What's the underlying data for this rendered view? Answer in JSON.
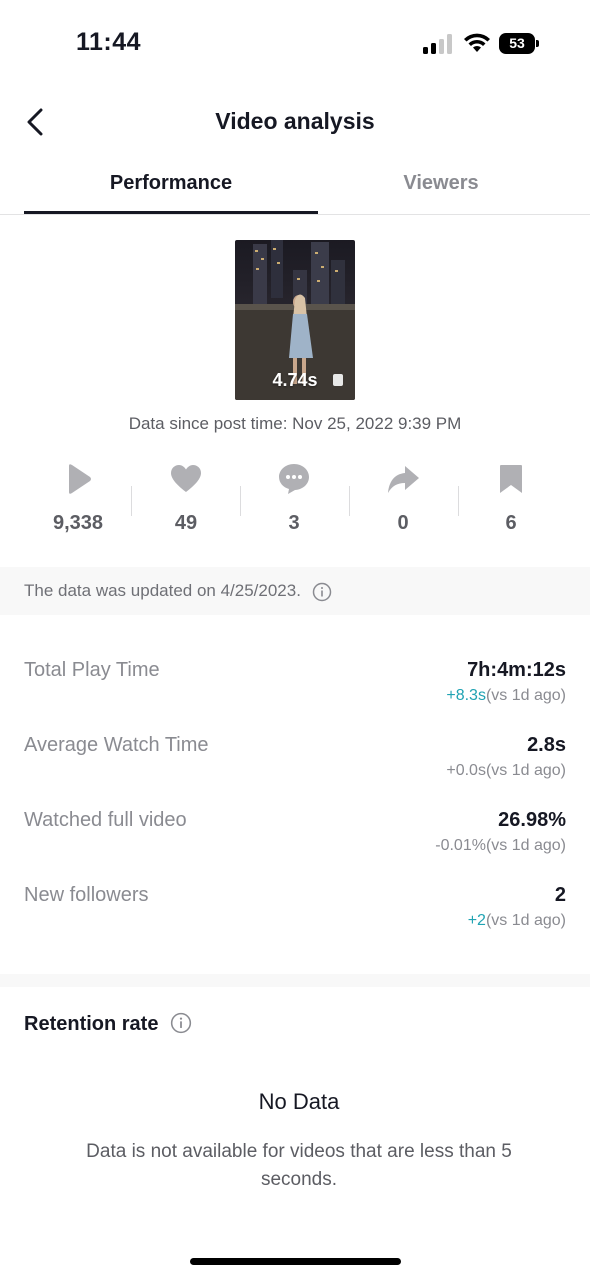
{
  "status_bar": {
    "time": "11:44",
    "battery": "53"
  },
  "header": {
    "title": "Video analysis"
  },
  "tabs": [
    {
      "label": "Performance",
      "active": true
    },
    {
      "label": "Viewers",
      "active": false
    }
  ],
  "video": {
    "duration": "4.74s",
    "post_time": "Data since post time: Nov 25, 2022 9:39 PM"
  },
  "stats": [
    {
      "icon": "play-icon",
      "value": "9,338"
    },
    {
      "icon": "heart-icon",
      "value": "49"
    },
    {
      "icon": "comment-icon",
      "value": "3"
    },
    {
      "icon": "share-icon",
      "value": "0"
    },
    {
      "icon": "bookmark-icon",
      "value": "6"
    }
  ],
  "updated_note": "The data was updated on 4/25/2023.",
  "metrics": [
    {
      "label": "Total Play Time",
      "value": "7h:4m:12s",
      "delta": "+8.3s",
      "delta_suffix": "(vs 1d ago)",
      "delta_color": "#20a3b3"
    },
    {
      "label": "Average Watch Time",
      "value": "2.8s",
      "delta": "+0.0s",
      "delta_suffix": "(vs 1d ago)",
      "delta_color": "#8a8b91"
    },
    {
      "label": "Watched full video",
      "value": "26.98%",
      "delta": "-0.01%",
      "delta_suffix": "(vs 1d ago)",
      "delta_color": "#8a8b91"
    },
    {
      "label": "New followers",
      "value": "2",
      "delta": "+2",
      "delta_suffix": "(vs 1d ago)",
      "delta_color": "#20a3b3"
    }
  ],
  "retention": {
    "title": "Retention rate",
    "empty_title": "No Data",
    "empty_desc": "Data is not available for videos that are less than 5 seconds."
  }
}
